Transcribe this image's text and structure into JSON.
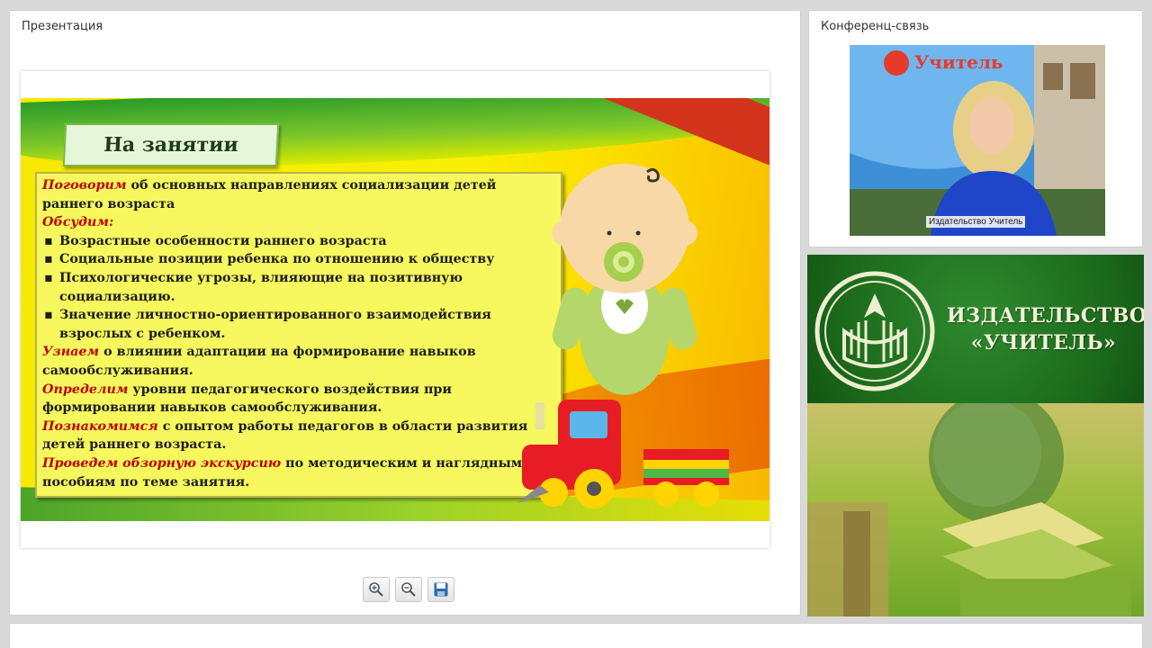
{
  "presentation": {
    "title": "Презентация",
    "slide": {
      "heading": "На занятии",
      "p1_kw": "Поговорим",
      "p1_rest": " об основных направлениях социализации детей раннего возраста",
      "p2_kw": "Обсудим:",
      "bullets": [
        "Возрастные особенности раннего возраста",
        "Социальные позиции  ребенка по отношению к обществу",
        "Психологические угрозы, влияющие на позитивную социализацию.",
        "Значение личностно-ориентированного взаимодействия взрослых с ребенком."
      ],
      "p3_kw": "Узнаем",
      "p3_rest": "  о влиянии адаптации на формирование навыков самообслуживания.",
      "p4_kw": "Определим",
      "p4_rest": " уровни педагогического  воздействия при формировании навыков самообслуживания.",
      "p5_kw": "Познакомимся",
      "p5_rest": "  с опытом работы педагогов в области развития детей раннего возраста.",
      "p6_kw": "Проведем обзорную экскурсию",
      "p6_rest": " по методическим  и наглядным пособиям по теме занятия."
    },
    "toolbar": {
      "zoom_in_icon": "zoom-in-icon",
      "zoom_out_icon": "zoom-out-icon",
      "save_icon": "save-icon"
    }
  },
  "conference": {
    "title": "Конференц-связь",
    "video_label": "Издательство Учитель"
  },
  "publisher": {
    "line1": "ИЗДАТЕЛЬСТВО",
    "line2": "«УЧИТЕЛЬ»"
  },
  "colors": {
    "keyword": "#c00000",
    "text_box": "#f6f85e",
    "logo_green": "#1b6a1b"
  }
}
